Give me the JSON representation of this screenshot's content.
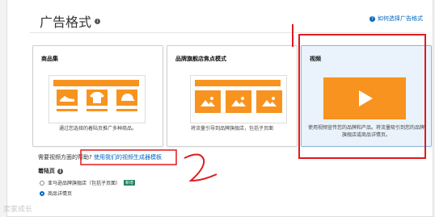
{
  "section": {
    "title": "广告格式",
    "help_link": "如何选择广告格式"
  },
  "cards": [
    {
      "title": "商品集",
      "description": "通过您选择的着陆页推广多种商品。",
      "selected": false
    },
    {
      "title": "品牌旗舰店焦点模式",
      "description": "将流量引导到品牌旗舰店，包括子页面",
      "selected": false
    },
    {
      "title": "视频",
      "description": "使用视频宣传您的品牌和产品。将流量吸引到您的品牌旗舰店或商品详情页。",
      "selected": true
    }
  ],
  "video_help": {
    "question": "需要视频方面的帮助?",
    "link": "使用我们的视频生成器模板"
  },
  "landing_page": {
    "title": "着陆页",
    "options": [
      {
        "label": "亚马逊品牌旗舰店（包括子页面）",
        "badge": "新增",
        "selected": false
      },
      {
        "label": "商品详情页",
        "selected": true
      }
    ]
  },
  "annotation": {
    "number": "2",
    "color": "#e0191e"
  },
  "watermark": "卖家成长",
  "colors": {
    "accent": "#f7931e",
    "link": "#0066c0",
    "selected_bg": "#eaf3fb"
  },
  "icons": {
    "product_images": [
      "shoe-icon",
      "tshirt-icon",
      "cap-icon"
    ],
    "brand_tiles": [
      "landscape-icon",
      "landscape-icon",
      "landscape-icon"
    ],
    "video": "play-icon"
  }
}
